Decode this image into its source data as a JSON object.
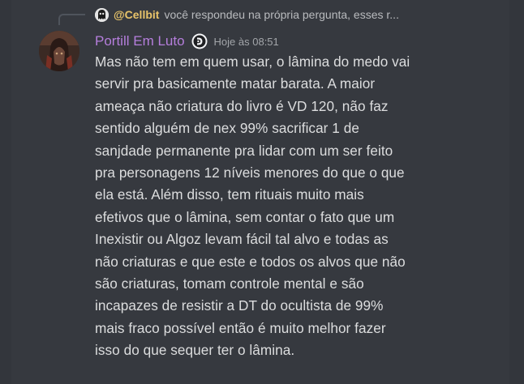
{
  "reply": {
    "author": "@Cellbit",
    "text": "você respondeu na própria pergunta, esses r..."
  },
  "message": {
    "username": "Portill Em Luto",
    "timestamp": "Hoje às 08:51",
    "lines": [
      "Mas não tem em quem usar, o lâmina do medo vai",
      "servir pra basicamente matar barata. A maior",
      "ameaça não criatura do livro é VD 120, não faz",
      "sentido alguém de nex 99% sacrificar 1 de",
      "sanjdade permanente pra lidar com um ser feito",
      "pra personagens 12 níveis menores do que o que",
      "ela está. Além disso, tem rituais muito mais",
      "efetivos que o lâmina, sem contar o fato que um",
      "Inexistir ou Algoz levam fácil tal alvo e todas as",
      "não criaturas e que este e todos os alvos que não",
      "são criaturas, tomam controle mental e são",
      "incapazes de resistir a DT do ocultista de 99%",
      "mais fraco possível então é muito melhor fazer",
      "isso do que sequer ter o lâmina."
    ]
  },
  "colors": {
    "background": "#36393f",
    "username": "#b57edc",
    "reply_author": "#e9c46a",
    "text": "#dcddde",
    "muted": "#a3a6aa"
  },
  "icons": {
    "reply_avatar": "ghost-avatar-icon",
    "role": "role-badge-icon"
  }
}
